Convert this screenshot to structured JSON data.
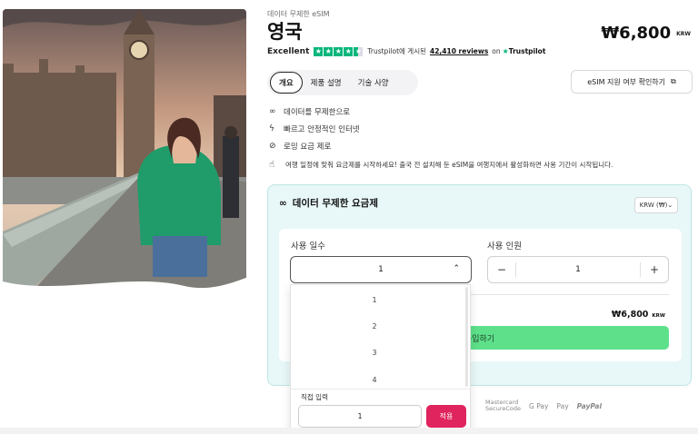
{
  "product": {
    "eyebrow": "데이터 무제한 eSIM",
    "title": "영국",
    "price": "₩6,800",
    "currency_code": "KRW"
  },
  "rating": {
    "label": "Excellent",
    "stars": 4.5,
    "listed_text": "Trustpilot에 게시된",
    "reviews_text": "42,410 reviews",
    "on_text": "on",
    "trustpilot": "Trustpilot"
  },
  "tabs": [
    {
      "label": "개요",
      "active": true
    },
    {
      "label": "제품 설명",
      "active": false
    },
    {
      "label": "기술 사양",
      "active": false
    }
  ],
  "compat_button": "eSIM 지원 여부 확인하기",
  "features": [
    {
      "icon": "infinity-icon",
      "glyph": "∞",
      "label": "데이터를 무제한으로"
    },
    {
      "icon": "bolt-icon",
      "glyph": "ϟ",
      "label": "빠르고 안정적인 인터넷"
    },
    {
      "icon": "no-roaming-icon",
      "glyph": "⊘",
      "label": "로밍 요금 제로"
    }
  ],
  "notice": "여행 일정에 맞춰 요금제를 시작하세요! 출국 전 설치해 둔 eSIM을 여행지에서 활성화하면 사용 기간이 시작됩니다.",
  "plan": {
    "title": "데이터 무제한 요금제",
    "currency_select": "KRW (₩)",
    "days_label": "사용 일수",
    "people_label": "사용 인원",
    "days_value": "1",
    "people_value": "1",
    "minus": "−",
    "plus": "+",
    "total": "₩6,800",
    "total_currency": "KRW",
    "buy_label": "구입하기"
  },
  "dropdown": {
    "options": [
      "1",
      "2",
      "3",
      "4"
    ],
    "custom_label": "직접 입력",
    "custom_value": "1",
    "apply_label": "적용"
  },
  "payments": {
    "mastercard_line1": "Mastercard",
    "mastercard_line2": "SecureCode",
    "gpay": "G Pay",
    "applepay": " Pay",
    "paypal": "PayPal"
  },
  "colors": {
    "accent_green": "#5ee08a",
    "trustpilot_green": "#00b67a",
    "apply_pink": "#e0245e",
    "plan_bg": "#e8f7f7"
  }
}
